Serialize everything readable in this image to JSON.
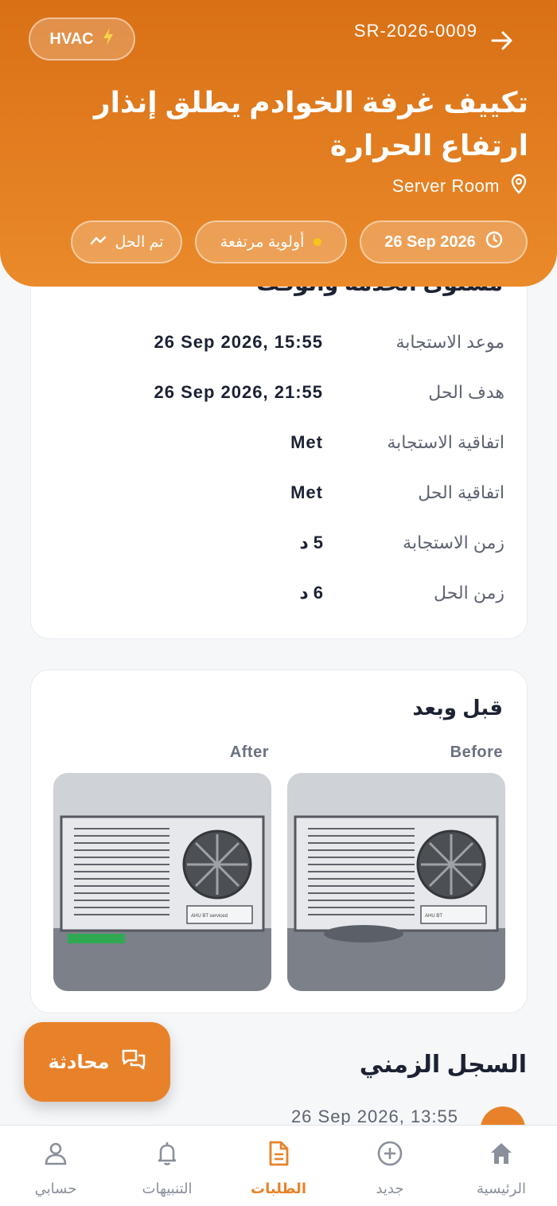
{
  "header": {
    "category": "HVAC",
    "request_id": "SR-2026-0009",
    "title": "تكييف غرفة الخوادم يطلق إنذار ارتفاع الحرارة",
    "location": "Server Room",
    "date": "26 Sep 2026",
    "priority": "أولوية مرتفعة",
    "status": "تم الحل",
    "colors": {
      "accent": "#e8822a",
      "priority_dot": "#f5c518"
    }
  },
  "sla": {
    "heading": "مستوى الخدمة والوقت",
    "rows": [
      {
        "label": "موعد الاستجابة",
        "value": "26 Sep 2026, 15:55"
      },
      {
        "label": "هدف الحل",
        "value": "26 Sep 2026, 21:55"
      },
      {
        "label": "اتفاقية الاستجابة",
        "value": "Met"
      },
      {
        "label": "اتفاقية الحل",
        "value": "Met"
      },
      {
        "label": "زمن الاستجابة",
        "value": "5 د"
      },
      {
        "label": "زمن الحل",
        "value": "6 د"
      }
    ]
  },
  "before_after": {
    "title": "قبل وبعد",
    "before_label": "Before",
    "after_label": "After",
    "before_tag": "AHU BT",
    "after_tag": "AHU BT serviced"
  },
  "timeline": {
    "title": "السجل الزمني",
    "first_time": "26 Sep 2026, 13:55"
  },
  "chat_button": "محادثة",
  "nav": [
    {
      "label": "الرئيسية",
      "icon": "home-icon"
    },
    {
      "label": "جديد",
      "icon": "plus-circle-icon"
    },
    {
      "label": "الطلبات",
      "icon": "document-icon",
      "active": true
    },
    {
      "label": "التنبيهات",
      "icon": "bell-icon"
    },
    {
      "label": "حسابي",
      "icon": "user-icon"
    }
  ]
}
